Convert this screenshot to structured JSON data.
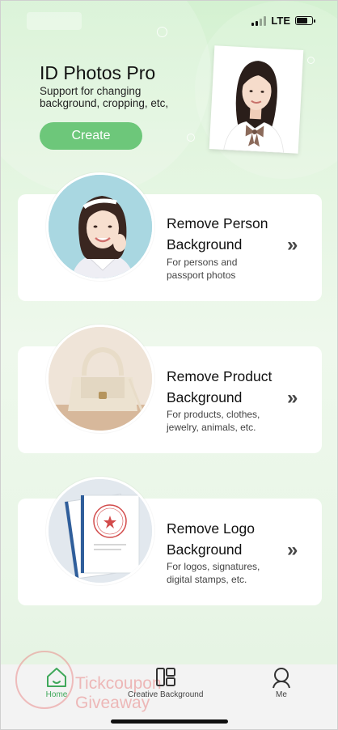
{
  "status_bar": {
    "network": "LTE",
    "battery_level": 0.7
  },
  "hero": {
    "title": "ID Photos Pro",
    "subtitle": "Support for changing background, cropping, etc,",
    "button": "Create"
  },
  "cards": [
    {
      "title_line1": "Remove Person",
      "title_line2": "Background",
      "desc_line1": "For persons and",
      "desc_line2": "passport photos",
      "arrow": "»"
    },
    {
      "title_line1": "Remove Product",
      "title_line2": "Background",
      "desc_line1": "For products, clothes,",
      "desc_line2": "jewelry, animals, etc.",
      "arrow": "»"
    },
    {
      "title_line1": "Remove Logo",
      "title_line2": "Background",
      "desc_line1": "For logos, signatures,",
      "desc_line2": "digital stamps, etc.",
      "arrow": "»"
    }
  ],
  "tabbar": [
    {
      "label": "Home",
      "icon": "home-icon",
      "active": true
    },
    {
      "label": "Creative Background",
      "icon": "layout-icon",
      "active": false
    },
    {
      "label": "Me",
      "icon": "person-icon",
      "active": false
    }
  ],
  "watermark": {
    "line1": "Tickcoupon",
    "line2": "Giveaway"
  },
  "colors": {
    "accent": "#6dc77a",
    "active_tab": "#3fa85a",
    "background_top": "#d4f1d1"
  }
}
